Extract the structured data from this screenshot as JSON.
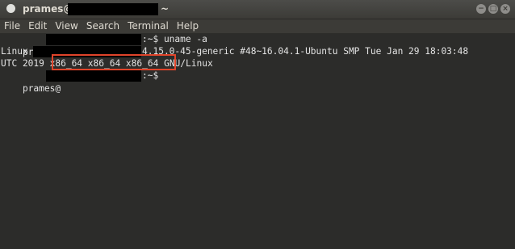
{
  "window": {
    "title_user": "prames@p",
    "title_path": "~",
    "controls": {
      "minimize": "−",
      "maximize": "□",
      "close": "×"
    }
  },
  "menu": [
    "File",
    "Edit",
    "View",
    "Search",
    "Terminal",
    "Help"
  ],
  "terminal": {
    "line1_user": "prames@",
    "line1_suffix": ":~$ uname -a",
    "line2_prefix": "Linux",
    "line2_suffix": "4.15.0-45-generic #48~16.04.1-Ubuntu SMP Tue Jan 29 18:03:48",
    "line3_prefix": "UTC 2019 ",
    "line3_highlight": "x86_64 x86_64 x86_64",
    "line3_suffix": " GNU/Linux",
    "line4_user": "prames@",
    "line4_suffix": ":~$"
  },
  "colors": {
    "terminal_bg": "#2c2c2a",
    "terminal_fg": "#e3e3e3",
    "highlight": "#e0442a",
    "redaction": "#000000"
  }
}
